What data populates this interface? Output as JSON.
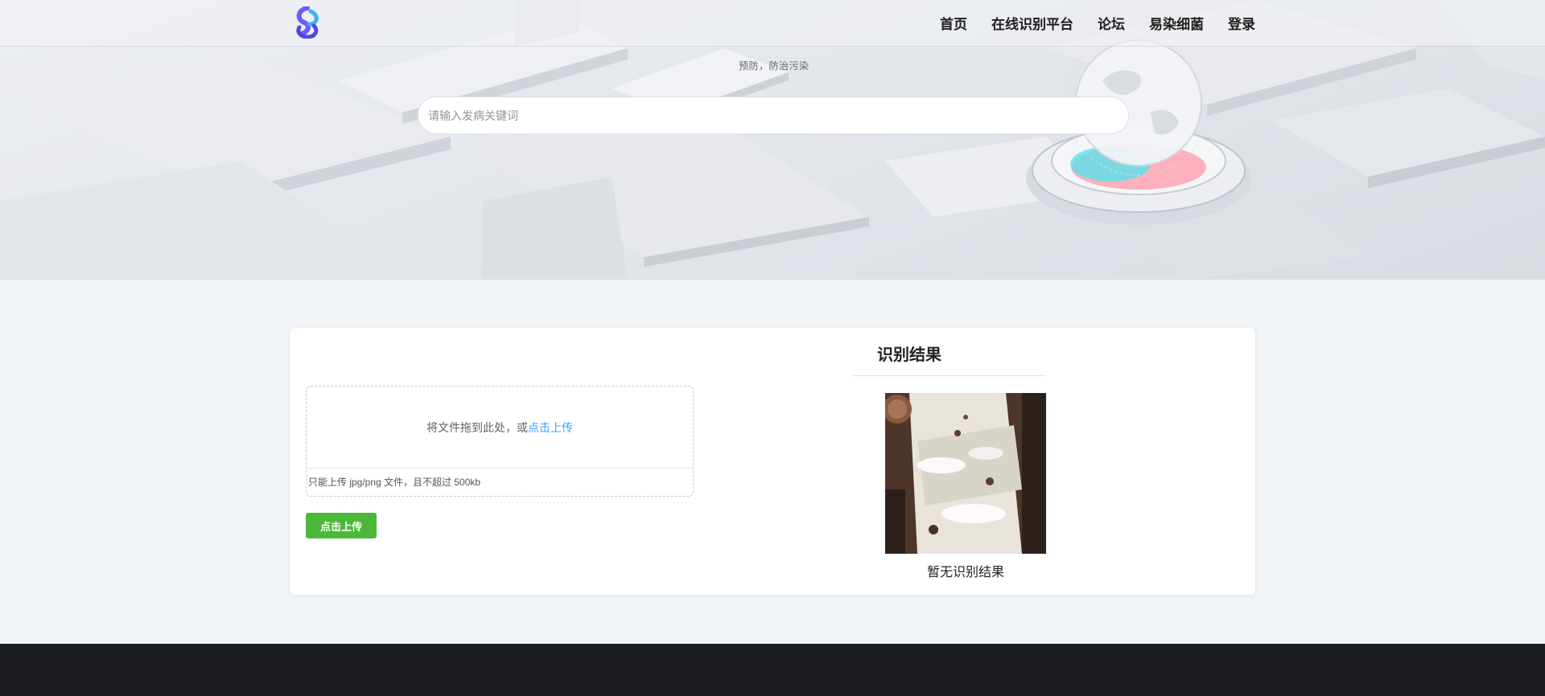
{
  "nav": {
    "items": [
      {
        "label": "首页"
      },
      {
        "label": "在线识别平台"
      },
      {
        "label": "论坛"
      },
      {
        "label": "易染细菌"
      },
      {
        "label": "登录"
      }
    ]
  },
  "hero": {
    "slogan": "预防，防治污染",
    "search_placeholder": "请输入发病关键词"
  },
  "upload": {
    "drop_text": "将文件拖到此处，或",
    "drop_link": "点击上传",
    "tip": "只能上传 jpg/png 文件，且不超过 500kb",
    "button_label": "点击上传"
  },
  "result": {
    "title": "识别结果",
    "empty_text": "暂无识别结果"
  },
  "colors": {
    "accent_blue": "#409eff",
    "button_green": "#4cb83a",
    "footer_bg": "#1b1d22",
    "page_bg": "#f1f4f7"
  }
}
